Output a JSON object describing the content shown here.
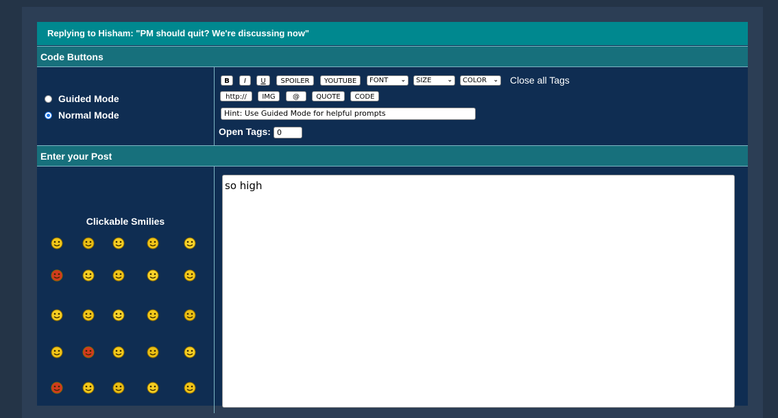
{
  "reply_header": "Replying to Hisham: \"PM should quit? We're discussing now\"",
  "sections": {
    "code_buttons": "Code Buttons",
    "enter_post": "Enter your Post"
  },
  "modes": {
    "guided": "Guided Mode",
    "normal": "Normal Mode",
    "selected": "normal"
  },
  "code_buttons": {
    "bold": "B",
    "italic": "I",
    "underline": "U",
    "spoiler": "SPOILER",
    "youtube": "YOUTUBE",
    "font": "FONT",
    "size": "SIZE",
    "color": "COLOR",
    "close_all": "Close all Tags",
    "http": "http://",
    "img": "IMG",
    "at": "@",
    "quote": "QUOTE",
    "code": "CODE"
  },
  "hint_text": "Hint: Use Guided Mode for helpful prompts",
  "open_tags": {
    "label": "Open Tags:",
    "value": "0"
  },
  "smilies": {
    "title": "Clickable Smilies",
    "icons": [
      "smile-icon",
      "sad-icon",
      "happy-icon",
      "grin-icon",
      "laugh-icon",
      "angry-icon",
      "shooting-icon",
      "rolleyes-icon",
      "surprised-icon",
      "confused-icon",
      "crying-icon",
      "scared-icon",
      "thinking-icon",
      "pair-icon",
      "cool-icon",
      "dizzy-icon",
      "mad-icon",
      "shocked-icon",
      "pensive-icon",
      "wink-icon",
      "rage-icon",
      "blush-icon",
      "hug-icon",
      "scratch-icon",
      "cheer-icon"
    ]
  },
  "post_text": "so high",
  "colors": {
    "title_bar": "#00888f",
    "section_bar": "#17707c",
    "panel": "#0f2d52",
    "background": "#243447"
  }
}
